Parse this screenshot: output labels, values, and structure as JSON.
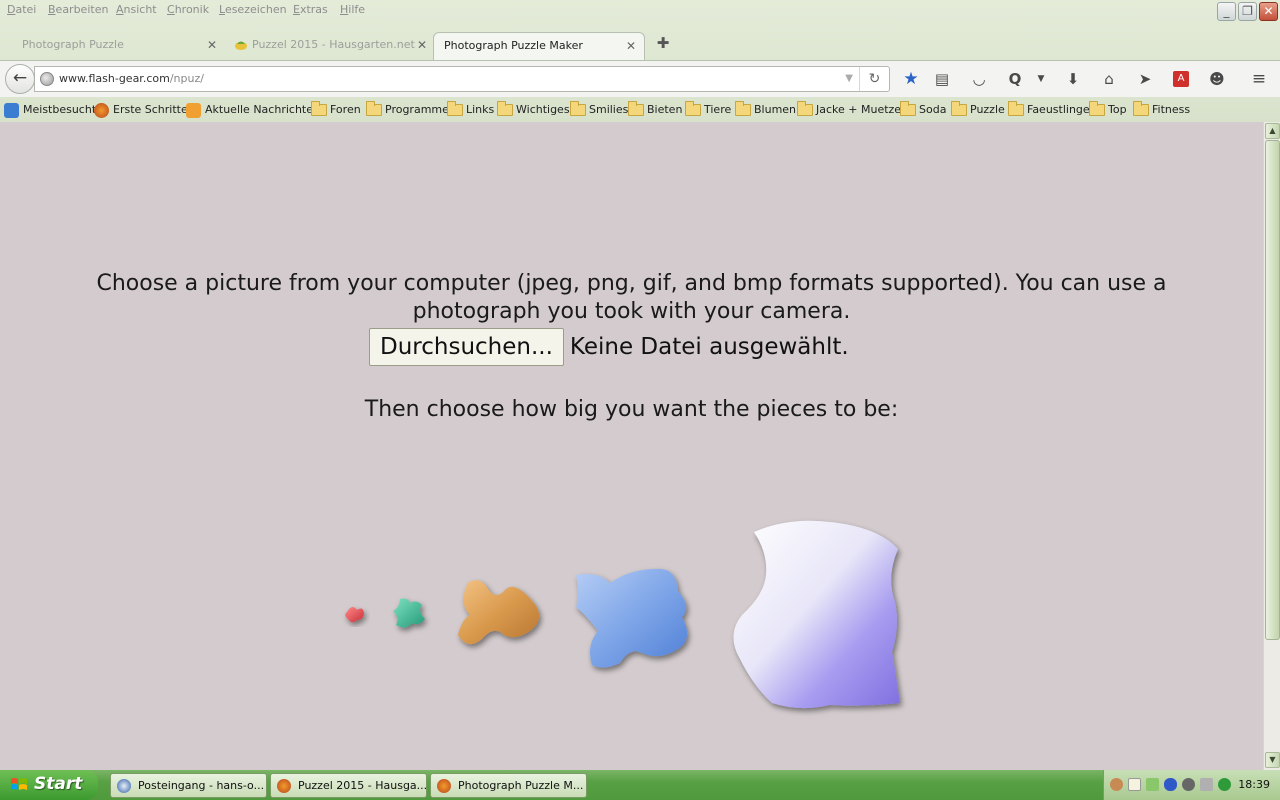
{
  "menu": [
    "Datei",
    "Bearbeiten",
    "Ansicht",
    "Chronik",
    "Lesezeichen",
    "Extras",
    "Hilfe"
  ],
  "tabs": [
    {
      "label": "Photograph Puzzle"
    },
    {
      "label": "Puzzel 2015 - Hausgarten.net"
    },
    {
      "label": "Photograph Puzzle Maker"
    }
  ],
  "address": {
    "host": "www.flash-gear.com",
    "path": "/npuz/"
  },
  "bookmarks": [
    "Meistbesucht",
    "Erste Schritte",
    "Aktuelle Nachrichten",
    "Foren",
    "Programme",
    "Links",
    "Wichtiges",
    "Smilies",
    "Bieten",
    "Tiere",
    "Blumen",
    "Jacke + Muetze",
    "Soda",
    "Puzzle",
    "Faeustlinge",
    "Top",
    "Fitness"
  ],
  "page": {
    "intro": "Choose a picture from your computer (jpeg, png, gif, and bmp formats supported). You can use a photograph you took with your camera.",
    "browse_button": "Durchsuchen...",
    "no_file": "Keine Datei ausgewählt.",
    "sizes_label": "Then choose how big you want the pieces to be:"
  },
  "taskbar": {
    "start": "Start",
    "tasks": [
      "Posteingang - hans-o...",
      "Puzzel 2015 - Hausga...",
      "Photograph Puzzle M..."
    ],
    "clock": "18:39"
  },
  "colors": {
    "page_bg": "#d3cbcd",
    "piece_red": "#e0454a",
    "piece_teal": "#3ab894",
    "piece_wood": "#d99a4e",
    "piece_blue": "#7fa6e8",
    "piece_white_lilac": "#9a8be8"
  },
  "icons": [
    "back-arrow-icon",
    "globe-icon",
    "reload-icon",
    "star-icon",
    "reading-list-icon",
    "pocket-icon",
    "q-icon",
    "download-icon",
    "home-icon",
    "send-icon",
    "acrobat-icon",
    "chat-icon",
    "menu-icon"
  ]
}
